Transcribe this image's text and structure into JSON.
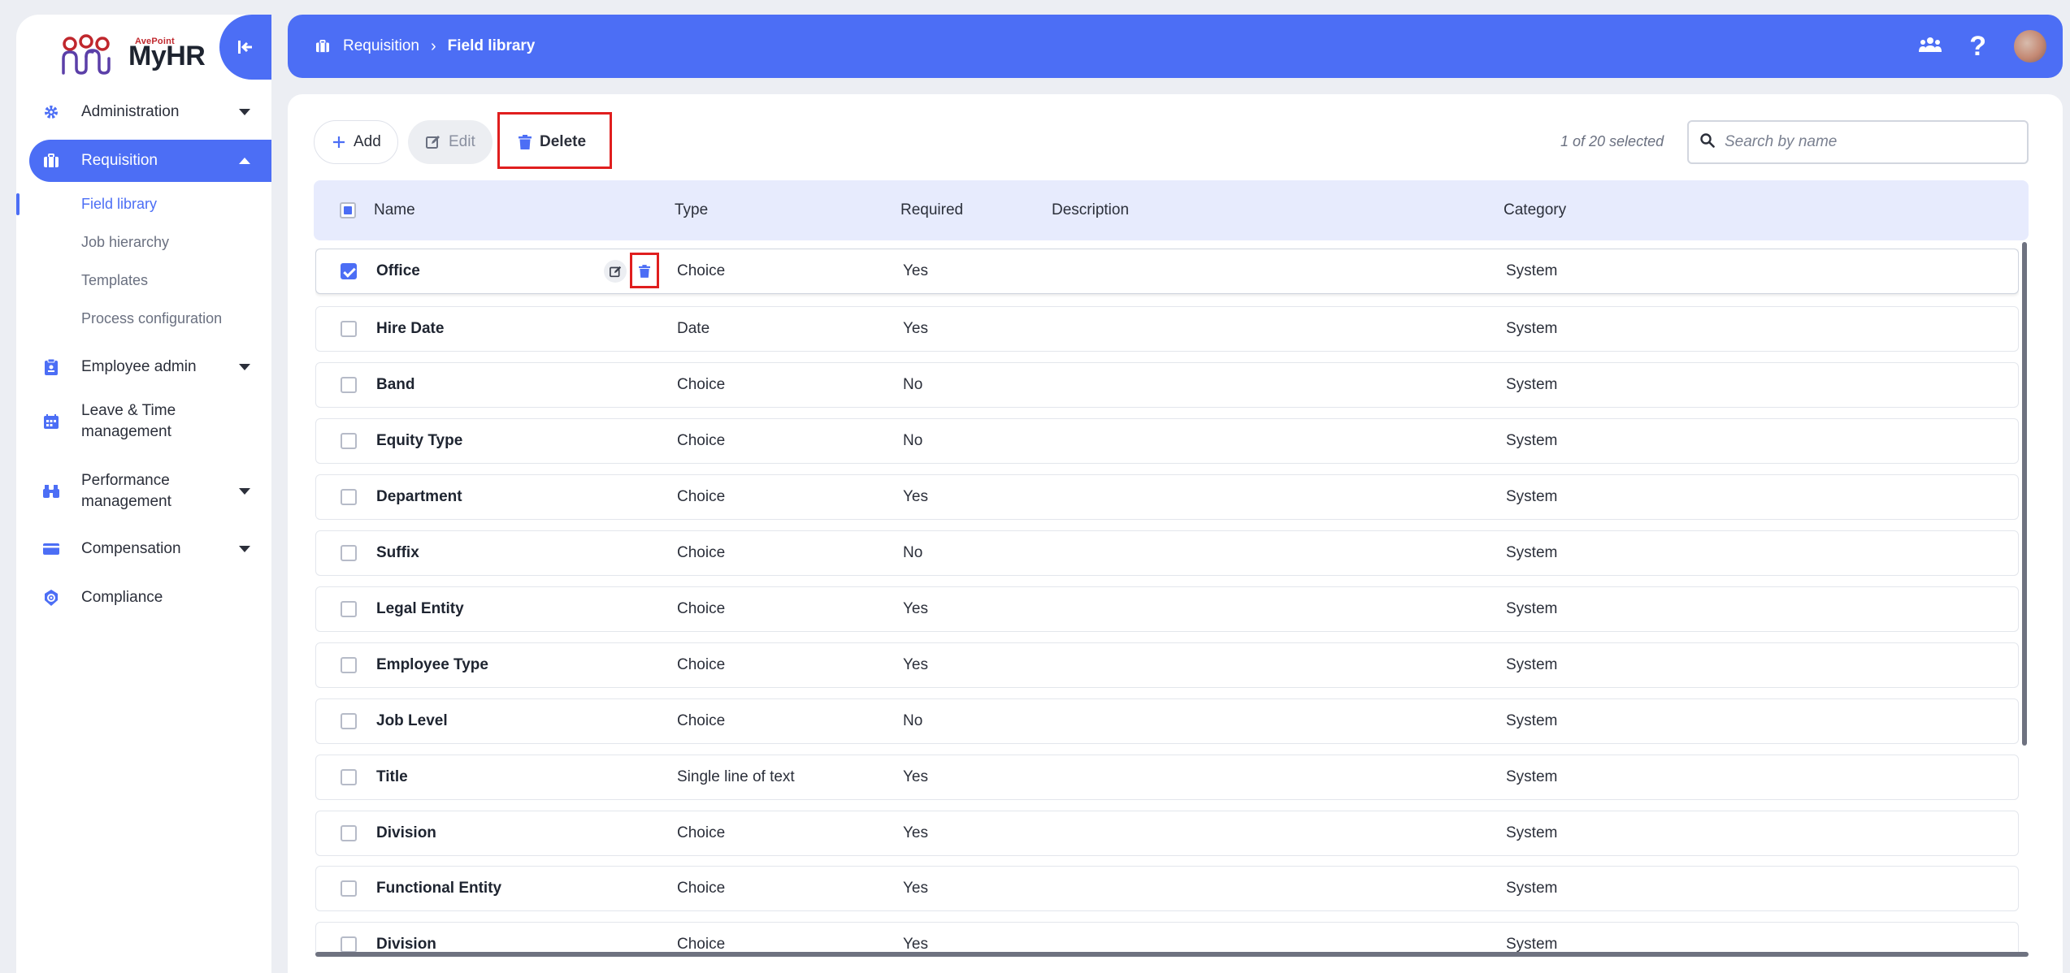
{
  "brand": {
    "company": "AvePoint",
    "name": "MyHR"
  },
  "colors": {
    "accent": "#4c6ef5",
    "highlight": "#e01e1e",
    "background": "#eceef3"
  },
  "sidebar": {
    "items": [
      {
        "label": "Administration",
        "icon": "gear-icon",
        "expandable": true,
        "expanded": false
      },
      {
        "label": "Requisition",
        "icon": "briefcase-icon",
        "expandable": true,
        "expanded": true,
        "active": true,
        "children": [
          "Field library",
          "Job hierarchy",
          "Templates",
          "Process configuration"
        ]
      },
      {
        "label": "Employee admin",
        "icon": "clipboard-icon",
        "expandable": true,
        "expanded": false
      },
      {
        "label": "Leave & Time management",
        "icon": "calendar-icon",
        "expandable": false
      },
      {
        "label": "Performance management",
        "icon": "binoculars-icon",
        "expandable": true,
        "expanded": false
      },
      {
        "label": "Compensation",
        "icon": "wallet-icon",
        "expandable": true,
        "expanded": false
      },
      {
        "label": "Compliance",
        "icon": "shield-gear-icon",
        "expandable": false
      }
    ],
    "selected_child": "Field library"
  },
  "header": {
    "breadcrumb": [
      "Requisition",
      "Field library"
    ],
    "icons": [
      "team-icon",
      "help-icon",
      "avatar"
    ]
  },
  "toolbar": {
    "add_label": "Add",
    "edit_label": "Edit",
    "delete_label": "Delete",
    "selection_status": "1 of 20 selected",
    "search_placeholder": "Search by name"
  },
  "table": {
    "columns": [
      "Name",
      "Type",
      "Required",
      "Description",
      "Category"
    ],
    "rows": [
      {
        "name": "Office",
        "type": "Choice",
        "required": "Yes",
        "description": "",
        "category": "System",
        "checked": true
      },
      {
        "name": "Hire Date",
        "type": "Date",
        "required": "Yes",
        "description": "",
        "category": "System",
        "checked": false
      },
      {
        "name": "Band",
        "type": "Choice",
        "required": "No",
        "description": "",
        "category": "System",
        "checked": false
      },
      {
        "name": "Equity Type",
        "type": "Choice",
        "required": "No",
        "description": "",
        "category": "System",
        "checked": false
      },
      {
        "name": "Department",
        "type": "Choice",
        "required": "Yes",
        "description": "",
        "category": "System",
        "checked": false
      },
      {
        "name": "Suffix",
        "type": "Choice",
        "required": "No",
        "description": "",
        "category": "System",
        "checked": false
      },
      {
        "name": "Legal Entity",
        "type": "Choice",
        "required": "Yes",
        "description": "",
        "category": "System",
        "checked": false
      },
      {
        "name": "Employee Type",
        "type": "Choice",
        "required": "Yes",
        "description": "",
        "category": "System",
        "checked": false
      },
      {
        "name": "Job Level",
        "type": "Choice",
        "required": "No",
        "description": "",
        "category": "System",
        "checked": false
      },
      {
        "name": "Title",
        "type": "Single line of text",
        "required": "Yes",
        "description": "",
        "category": "System",
        "checked": false
      },
      {
        "name": "Division",
        "type": "Choice",
        "required": "Yes",
        "description": "",
        "category": "System",
        "checked": false
      },
      {
        "name": "Functional Entity",
        "type": "Choice",
        "required": "Yes",
        "description": "",
        "category": "System",
        "checked": false
      },
      {
        "name": "Division",
        "type": "Choice",
        "required": "Yes",
        "description": "",
        "category": "System",
        "checked": false
      }
    ]
  }
}
